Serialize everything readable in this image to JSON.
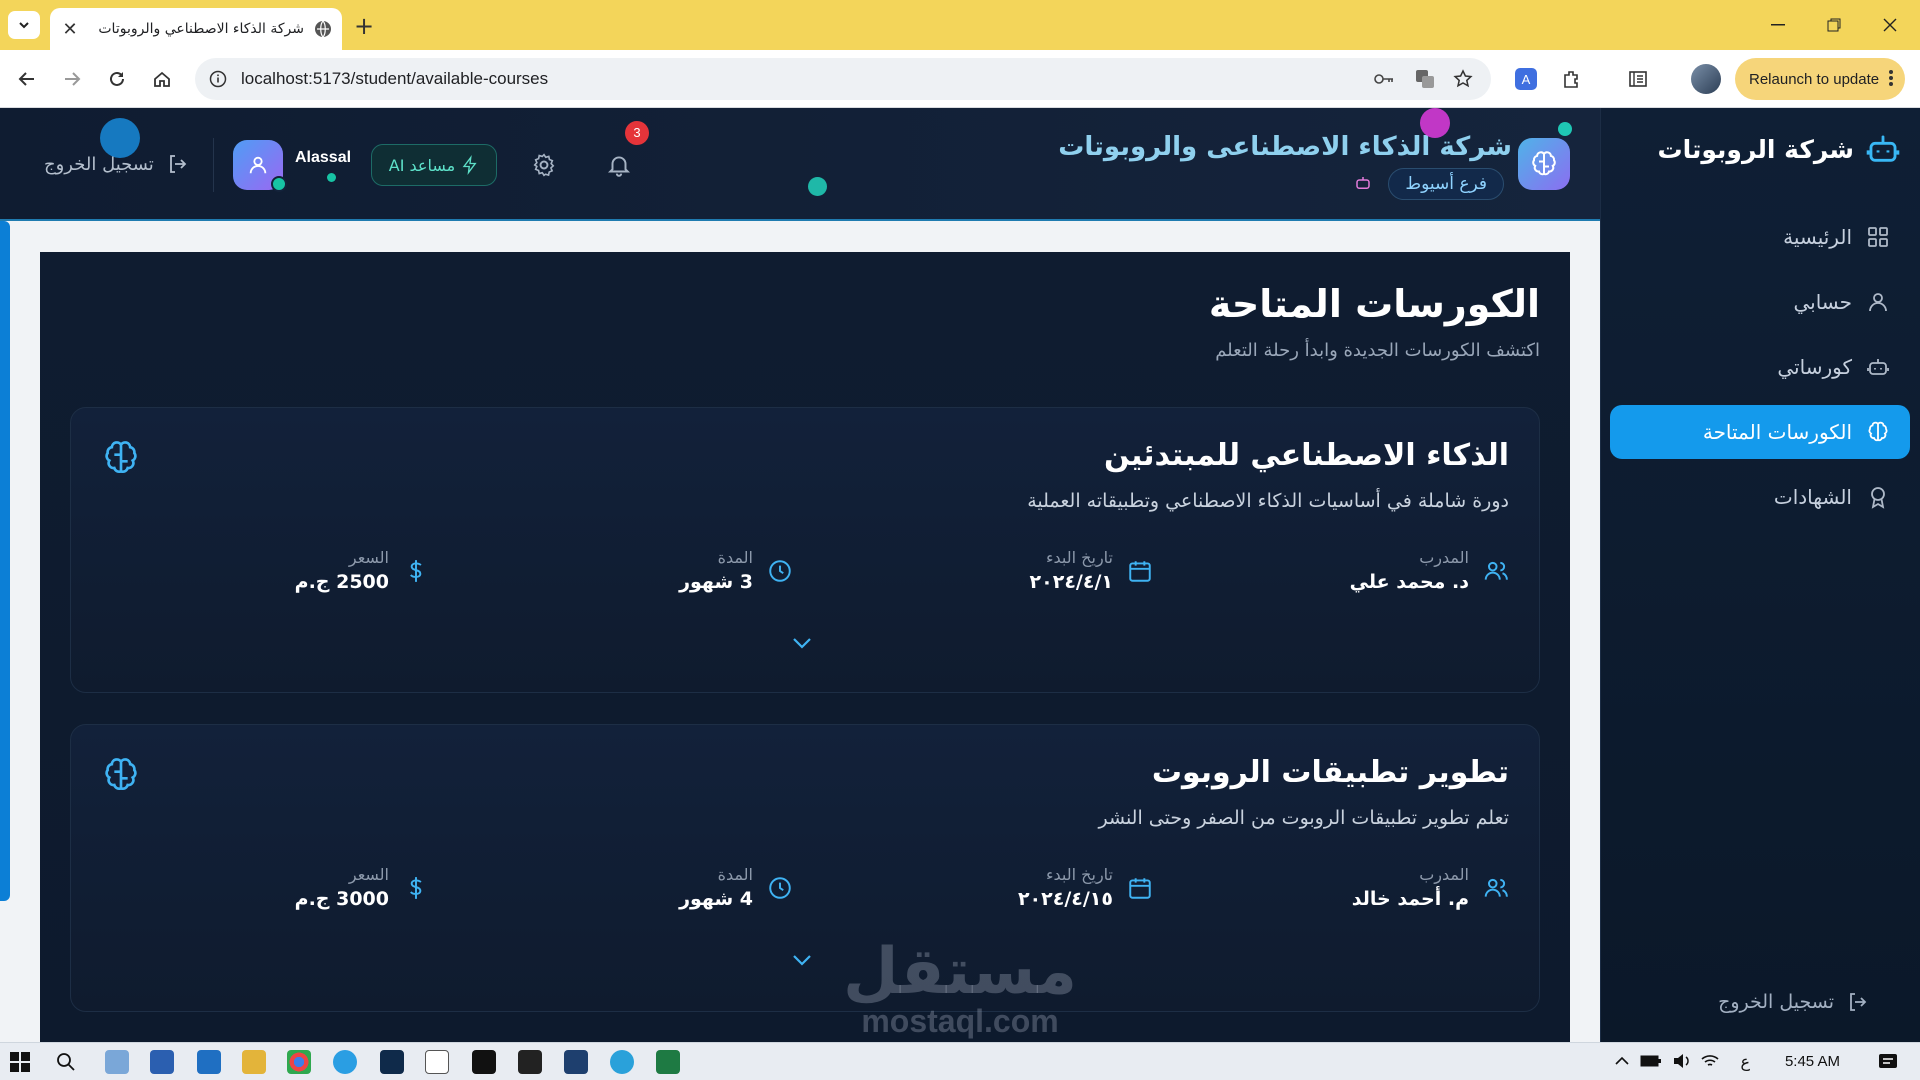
{
  "browser": {
    "tab_title": "شركة الذكاء الاصطناعي والروبوتات",
    "url": "localhost:5173/student/available-courses",
    "relaunch_label": "Relaunch to update"
  },
  "sidebar": {
    "brand": "شركة الروبوتات",
    "items": [
      {
        "label": "الرئيسية",
        "icon": "grid-icon"
      },
      {
        "label": "حسابي",
        "icon": "user-icon"
      },
      {
        "label": "كورساتي",
        "icon": "robot-icon"
      },
      {
        "label": "الكورسات المتاحة",
        "icon": "brain-icon",
        "active": true
      },
      {
        "label": "الشهادات",
        "icon": "award-icon"
      }
    ],
    "logout": "تسجيل الخروج"
  },
  "header": {
    "title": "شركة الذكاء الاصطناعى والروبوتات",
    "branch": "فرع أسيوط",
    "notifications_count": "3",
    "ai_button": "AI مساعد",
    "username": "Alassal",
    "logout": "تسجيل الخروج"
  },
  "page": {
    "title": "الكورسات المتاحة",
    "subtitle": "اكتشف الكورسات الجديدة وابدأ رحلة التعلم"
  },
  "labels": {
    "instructor": "المدرب",
    "start_date": "تاريخ البدء",
    "duration": "المدة",
    "price": "السعر"
  },
  "courses": [
    {
      "title": "الذكاء الاصطناعي للمبتدئين",
      "description": "دورة شاملة في أساسيات الذكاء الاصطناعي وتطبيقاته العملية",
      "instructor": "د. محمد علي",
      "start_date": "٢٠٢٤/٤/١",
      "duration": "3 شهور",
      "price": "2500 ج.م"
    },
    {
      "title": "تطوير تطبيقات الروبوت",
      "description": "تعلم تطوير تطبيقات الروبوت من الصفر وحتى النشر",
      "instructor": "م. أحمد خالد",
      "start_date": "٢٠٢٤/٤/١٥",
      "duration": "4 شهور",
      "price": "3000 ج.م"
    }
  ],
  "watermark": {
    "arabic": "مستقل",
    "latin": "mostaql.com"
  },
  "taskbar": {
    "time": "5:45 AM",
    "lang": "ع"
  }
}
